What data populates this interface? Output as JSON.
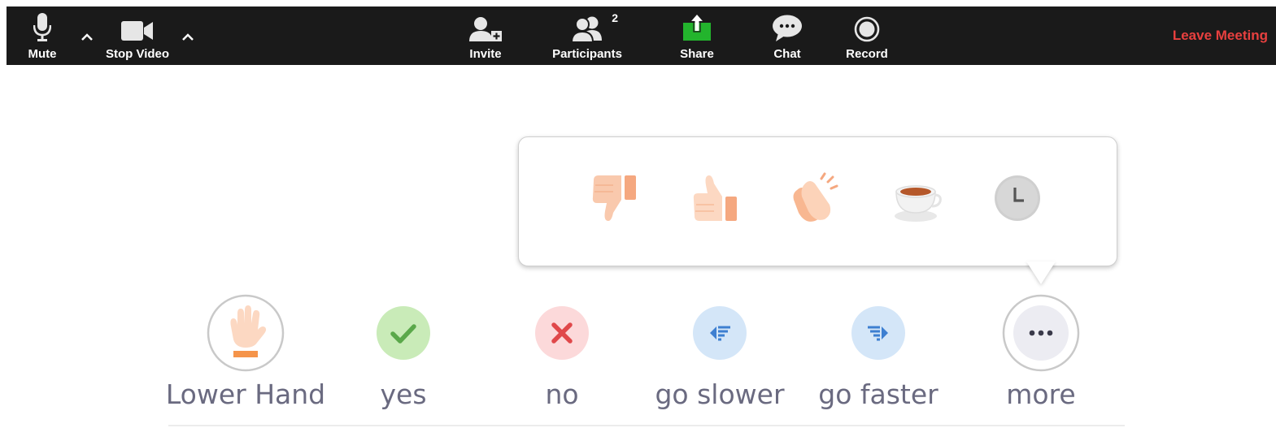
{
  "toolbar": {
    "mute_label": "Mute",
    "stop_video_label": "Stop Video",
    "invite_label": "Invite",
    "participants_label": "Participants",
    "participants_count": "2",
    "share_label": "Share",
    "chat_label": "Chat",
    "record_label": "Record",
    "leave_label": "Leave Meeting",
    "colors": {
      "background": "#1a1a1a",
      "share_accent": "#23b42d",
      "leave": "#e8403f"
    }
  },
  "reactions": {
    "items": [
      {
        "icon": "thumbs-down-icon"
      },
      {
        "icon": "thumbs-up-icon"
      },
      {
        "icon": "clap-icon"
      },
      {
        "icon": "coffee-icon"
      },
      {
        "icon": "clock-icon"
      }
    ]
  },
  "feedback": {
    "items": [
      {
        "label": "Lower Hand",
        "icon": "raised-hand-icon"
      },
      {
        "label": "yes",
        "icon": "check-icon",
        "color": "#5aa84a"
      },
      {
        "label": "no",
        "icon": "close-icon",
        "color": "#e0484a"
      },
      {
        "label": "go slower",
        "icon": "go-slower-icon",
        "color": "#3d7fd1"
      },
      {
        "label": "go faster",
        "icon": "go-faster-icon",
        "color": "#3d7fd1"
      },
      {
        "label": "more",
        "icon": "more-icon"
      }
    ]
  }
}
